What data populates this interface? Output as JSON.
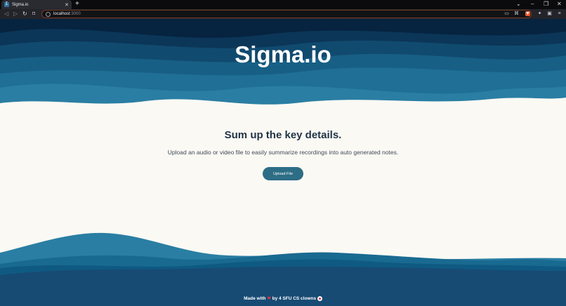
{
  "browser": {
    "tab_title": "Sigma.io",
    "tab_close": "✕",
    "new_tab": "+",
    "url_host": "localhost",
    "url_port": ":3000"
  },
  "hero": {
    "title": "Sigma.io"
  },
  "main": {
    "headline": "Sum up the key details.",
    "subtext": "Upload an audio or video file to easily summarize recordings into auto generated notes.",
    "upload_label": "Upload File"
  },
  "footer": {
    "made_with": "Made with",
    "by_text": "by 4 SFU CS clowns"
  },
  "colors": {
    "hero_dark": "#062340",
    "wave_teal": "#2a7ea3",
    "button": "#2d6d86",
    "background": "#fbf9f4"
  }
}
